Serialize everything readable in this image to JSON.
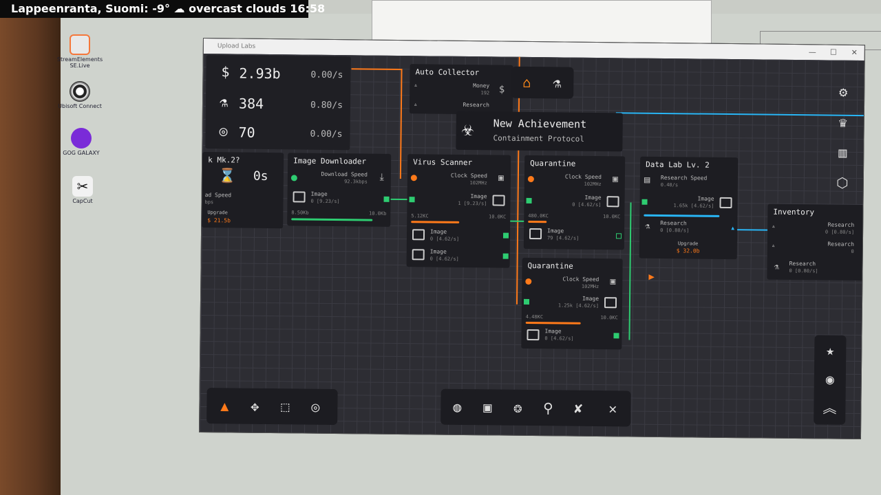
{
  "weather": {
    "text": "Lappeenranta, Suomi: -9°  ☁  overcast clouds 16:58"
  },
  "desktop": {
    "icons": [
      {
        "label": "StreamElements SE.Live",
        "color": "#e0e0e0"
      },
      {
        "label": "Ubisoft Connect",
        "color": "#222"
      },
      {
        "label": "GOG GALAXY",
        "color": "#7a2bd8"
      },
      {
        "label": "CapCut",
        "color": "#111"
      }
    ]
  },
  "window": {
    "title": "Upload Labs",
    "minimize": "—",
    "maximize": "☐",
    "close": "✕"
  },
  "resources": {
    "money": "2.93b",
    "money_rate": "0.00/s",
    "research": "384",
    "research_rate": "0.80/s",
    "tokens": "70",
    "tokens_rate": "0.00/s"
  },
  "achievement": {
    "title": "New Achievement",
    "subtitle": "Containment Protocol"
  },
  "timer": {
    "header": "k Mk.2?",
    "value": "0s",
    "speed_label": "ad Speed",
    "speed_value": "bps",
    "upgrade_label": "Upgrade",
    "upgrade_cost": "$ 21.5b"
  },
  "auto_collector": {
    "title": "Auto Collector",
    "money_label": "Money",
    "money_value": "192",
    "research_label": "Research"
  },
  "downloader": {
    "title": "Image Downloader",
    "speed_label": "Download Speed",
    "speed_value": "92.3kbps",
    "out_label": "Image",
    "out_value": "0 [9.23/s]",
    "size": "8.50Kb",
    "cap": "10.0Kb"
  },
  "scanner": {
    "title": "Virus Scanner",
    "clock_label": "Clock Speed",
    "clock_value": "102MHz",
    "in_label": "Image",
    "in_value": "1 [9.23/s]",
    "progress": "5.12KC",
    "cap": "10.0KC",
    "out1_label": "Image",
    "out1_value": "0 [4.62/s]",
    "out2_label": "Image",
    "out2_value": "0 [4.62/s]",
    "progress_fraction": 0.51
  },
  "quarantine1": {
    "title": "Quarantine",
    "clock_label": "Clock Speed",
    "clock_value": "102MHz",
    "in_label": "Image",
    "in_value": "0 [4.62/s]",
    "progress": "480.0KC",
    "cap": "10.0KC",
    "out_label": "Image",
    "out_value": "79 [4.62/s]",
    "progress_fraction": 0.2
  },
  "quarantine2": {
    "title": "Quarantine",
    "clock_label": "Clock Speed",
    "clock_value": "102MHz",
    "in_label": "Image",
    "in_value": "1.25k [4.62/s]",
    "progress": "4.48KC",
    "cap": "10.0KC",
    "out_label": "Image",
    "out_value": "0 [4.62/s]",
    "progress_fraction": 0.6
  },
  "datalab": {
    "title": "Data Lab Lv. 2",
    "speed_label": "Research Speed",
    "speed_value": "0.40/s",
    "in_label": "Image",
    "in_value": "1.65k [4.62/s]",
    "out_label": "Research",
    "out_value": "0 [0.80/s]",
    "upgrade_label": "Upgrade",
    "upgrade_cost": "$ 32.0b",
    "progress_fraction": 0.95
  },
  "inventory": {
    "title": "Inventory",
    "r1_label": "Research",
    "r1_value": "0 [0.80/s]",
    "r2_label": "Research",
    "r2_value": "0",
    "r3_label": "Research",
    "r3_value": "0 [0.80/s]"
  },
  "top_buttons": {
    "home": "home-icon",
    "lab": "flask-icon"
  },
  "right_buttons": [
    "gear-icon",
    "trophy-icon",
    "book-icon",
    "hexagon-icon"
  ],
  "right_bottom_buttons": [
    "star-icon",
    "target-icon",
    "chevrons-up-icon"
  ],
  "left_tools": [
    "pointer-icon",
    "move-icon",
    "select-box-icon",
    "circle-icon"
  ],
  "bottom_tools": [
    "globe-icon",
    "cpu-icon",
    "aperture-icon",
    "microscope-icon",
    "tools-icon",
    "close-icon"
  ],
  "colors": {
    "orange": "#ff7a1a",
    "green": "#2ecc71",
    "blue": "#29b6f6",
    "accent_bg": "#1d1d22"
  }
}
